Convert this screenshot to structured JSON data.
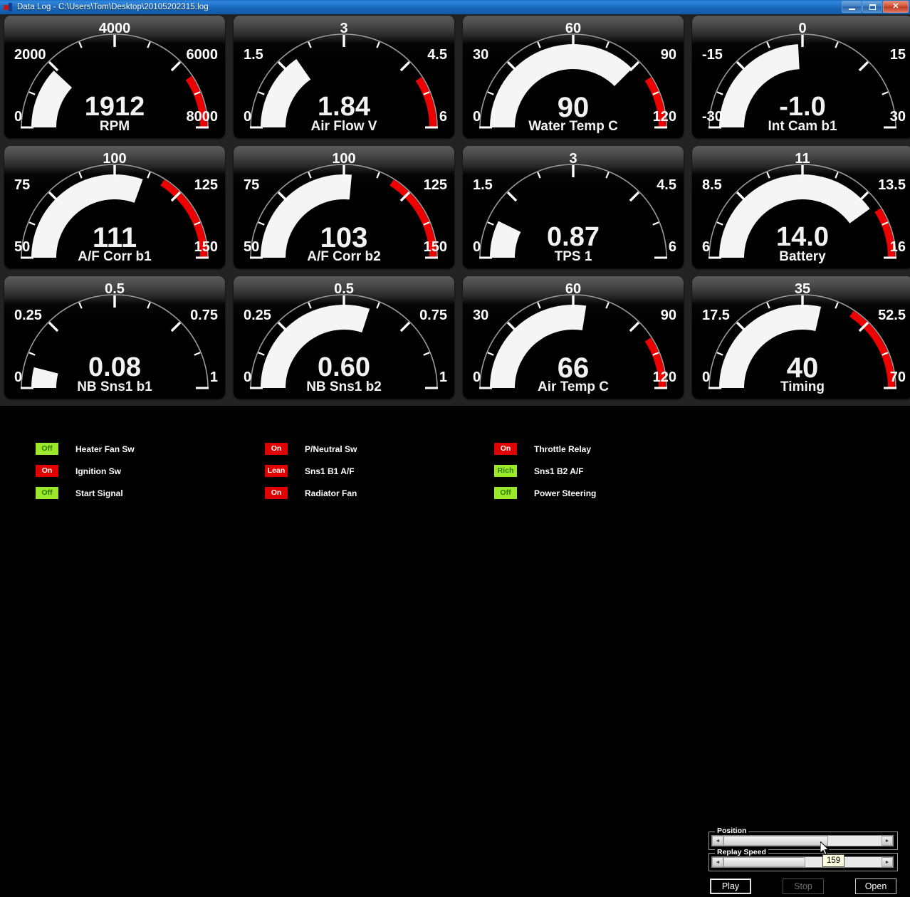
{
  "window": {
    "title": "Data Log - C:\\Users\\Tom\\Desktop\\20105202315.log",
    "icon": "app-icon",
    "minimize_label": "",
    "maximize_label": "",
    "close_label": "✕"
  },
  "gauges": [
    {
      "name": "rpm",
      "label": "RPM",
      "value": "1912",
      "value_num": 1912,
      "min": 0,
      "max": 8000,
      "min_label": "0",
      "max_label": "8000",
      "majors": [
        "2000",
        "4000",
        "6000"
      ],
      "redline_start": 6500,
      "has_red": true,
      "value_font": 38
    },
    {
      "name": "air-flow-v",
      "label": "Air Flow V",
      "value": "1.84",
      "value_num": 1.84,
      "min": 0,
      "max": 6,
      "min_label": "0",
      "max_label": "6",
      "majors": [
        "1.5",
        "3",
        "4.5"
      ],
      "redline_start": 4.9,
      "has_red": true,
      "value_font": 38
    },
    {
      "name": "water-temp-c",
      "label": "Water Temp C",
      "value": "90",
      "value_num": 90,
      "min": 0,
      "max": 120,
      "min_label": "0",
      "max_label": "120",
      "majors": [
        "30",
        "60",
        "90"
      ],
      "redline_start": 98,
      "has_red": true,
      "value_font": 40
    },
    {
      "name": "int-cam-b1",
      "label": "Int Cam b1",
      "value": "-1.0",
      "value_num": -1.0,
      "min": -30,
      "max": 30,
      "min_label": "-30",
      "max_label": "30",
      "majors": [
        "-15",
        "0",
        "15"
      ],
      "redline_start": null,
      "has_red": false,
      "value_font": 38
    },
    {
      "name": "af-corr-b1",
      "label": "A/F Corr b1",
      "value": "111",
      "value_num": 111,
      "min": 50,
      "max": 150,
      "min_label": "50",
      "max_label": "150",
      "majors": [
        "75",
        "100",
        "125"
      ],
      "redline_start": 118,
      "has_red": true,
      "value_font": 40
    },
    {
      "name": "af-corr-b2",
      "label": "A/F Corr b2",
      "value": "103",
      "value_num": 103,
      "min": 50,
      "max": 150,
      "min_label": "50",
      "max_label": "150",
      "majors": [
        "75",
        "100",
        "125"
      ],
      "redline_start": 118,
      "has_red": true,
      "value_font": 40
    },
    {
      "name": "tps-1",
      "label": "TPS 1",
      "value": "0.87",
      "value_num": 0.87,
      "min": 0,
      "max": 6,
      "min_label": "0",
      "max_label": "6",
      "majors": [
        "1.5",
        "3",
        "4.5"
      ],
      "redline_start": null,
      "has_red": false,
      "value_font": 38
    },
    {
      "name": "battery",
      "label": "Battery",
      "value": "14.0",
      "value_num": 14.0,
      "min": 6,
      "max": 16,
      "min_label": "6",
      "max_label": "16",
      "majors": [
        "8.5",
        "11",
        "13.5"
      ],
      "redline_start": 14.2,
      "has_red": true,
      "value_font": 38
    },
    {
      "name": "nb-sns1-b1",
      "label": "NB Sns1 b1",
      "value": "0.08",
      "value_num": 0.08,
      "min": 0,
      "max": 1,
      "min_label": "0",
      "max_label": "1",
      "majors": [
        "0.25",
        "0.5",
        "0.75"
      ],
      "redline_start": null,
      "has_red": false,
      "value_font": 38
    },
    {
      "name": "nb-sns1-b2",
      "label": "NB Sns1 b2",
      "value": "0.60",
      "value_num": 0.6,
      "min": 0,
      "max": 1,
      "min_label": "0",
      "max_label": "1",
      "majors": [
        "0.25",
        "0.5",
        "0.75"
      ],
      "redline_start": null,
      "has_red": false,
      "value_font": 38
    },
    {
      "name": "air-temp-c",
      "label": "Air Temp C",
      "value": "66",
      "value_num": 66,
      "min": 0,
      "max": 120,
      "min_label": "0",
      "max_label": "120",
      "majors": [
        "30",
        "60",
        "90"
      ],
      "redline_start": 98,
      "has_red": true,
      "value_font": 40
    },
    {
      "name": "timing",
      "label": "Timing",
      "value": "40",
      "value_num": 40,
      "min": 0,
      "max": 70,
      "min_label": "0",
      "max_label": "70",
      "majors": [
        "17.5",
        "35",
        "52.5"
      ],
      "redline_start": 48,
      "has_red": true,
      "value_font": 40
    }
  ],
  "indicators": [
    {
      "name": "heater-fan-sw",
      "state": "Off",
      "color": "green",
      "label": "Heater Fan Sw",
      "col": 0,
      "row": 0
    },
    {
      "name": "ignition-sw",
      "state": "On",
      "color": "red",
      "label": "Ignition Sw",
      "col": 0,
      "row": 1
    },
    {
      "name": "start-signal",
      "state": "Off",
      "color": "green",
      "label": "Start Signal",
      "col": 0,
      "row": 2
    },
    {
      "name": "p-neutral-sw",
      "state": "On",
      "color": "red",
      "label": "P/Neutral Sw",
      "col": 1,
      "row": 0
    },
    {
      "name": "sns1-b1-af",
      "state": "Lean",
      "color": "red",
      "label": "Sns1 B1 A/F",
      "col": 1,
      "row": 1
    },
    {
      "name": "radiator-fan",
      "state": "On",
      "color": "red",
      "label": "Radiator Fan",
      "col": 1,
      "row": 2
    },
    {
      "name": "throttle-relay",
      "state": "On",
      "color": "red",
      "label": "Throttle Relay",
      "col": 2,
      "row": 0
    },
    {
      "name": "sns1-b2-af",
      "state": "Rich",
      "color": "green",
      "label": "Sns1 B2 A/F",
      "col": 2,
      "row": 1
    },
    {
      "name": "power-steering",
      "state": "Off",
      "color": "green",
      "label": "Power Steering",
      "col": 2,
      "row": 2
    }
  ],
  "controls": {
    "position_legend": "Position",
    "position_thumb_pct": 0,
    "position_value": 66,
    "replay_legend": "Replay Speed",
    "replay_value": 52,
    "tooltip_value": "159",
    "play_label": "Play",
    "stop_label": "Stop",
    "open_label": "Open",
    "arrow_left": "◄",
    "arrow_right": "►"
  },
  "colors": {
    "redline": "#ee0000",
    "needle_fill": "#f5f5f5",
    "badge_on": "#e00000",
    "badge_off": "#9ce82b",
    "panel_bg": "#000000",
    "app_bg": "#232323",
    "title_bar": "#1867b9"
  }
}
